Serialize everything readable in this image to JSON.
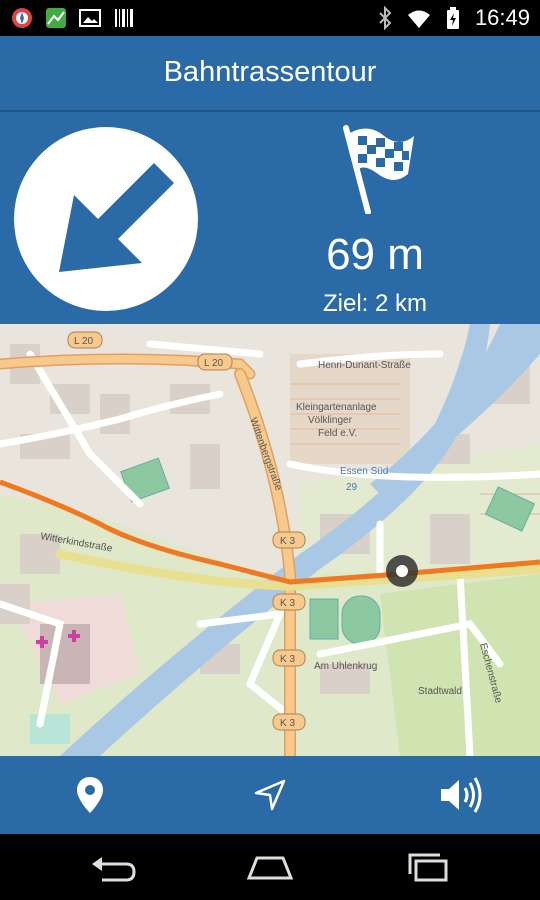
{
  "status_bar": {
    "time": "16:49",
    "left_icons": [
      "compass-app-icon",
      "map-app-icon",
      "image-icon",
      "barcode-icon"
    ],
    "right_icons": [
      "bluetooth-icon",
      "wifi-icon",
      "battery-icon"
    ]
  },
  "header": {
    "title": "Bahntrassentour"
  },
  "navigation": {
    "turn_icon": "arrow-down-left-icon",
    "goal_icon": "checkered-flag-icon",
    "distance": "69 m",
    "goal": "Ziel: 2 km"
  },
  "map": {
    "road_labels": [
      "L 20",
      "L 20",
      "K 3",
      "K 3",
      "K 3",
      "K 3",
      "29"
    ],
    "street_labels": [
      "Wittenbergstraße",
      "Henri-Dunant-Straße",
      "Kleingartenanlage",
      "Völklinger",
      "Feld e.V.",
      "Essen Süd",
      "Witterkindstraße",
      "Stadtwald",
      "Am Uhlenkrug",
      "Eschenstraße"
    ],
    "route_color": "#f07820",
    "water_color": "#a9c8e6"
  },
  "bottom_bar": {
    "buttons": [
      "location-pin-icon",
      "navigation-arrow-icon",
      "speaker-icon"
    ]
  },
  "system_nav": {
    "buttons": [
      "back-icon",
      "home-icon",
      "recents-icon"
    ]
  }
}
